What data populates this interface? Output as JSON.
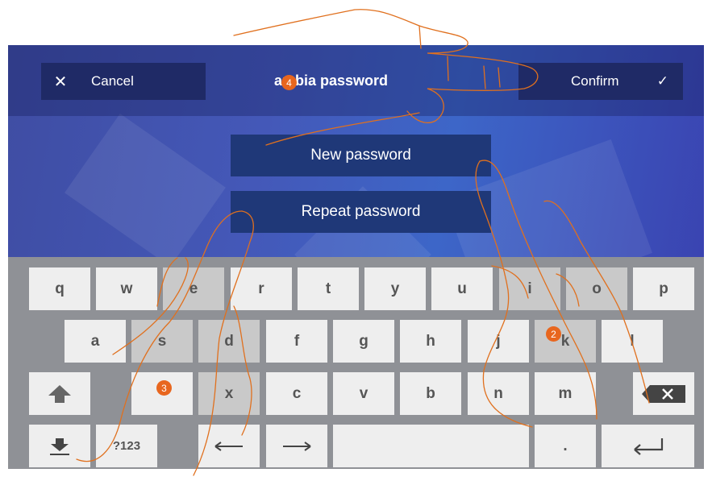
{
  "header": {
    "cancel_label": "Cancel",
    "confirm_label": "Confirm",
    "title": "ambia password"
  },
  "form": {
    "new_password_label": "New password",
    "repeat_password_label": "Repeat password"
  },
  "keyboard": {
    "row1": [
      "q",
      "w",
      "e",
      "r",
      "t",
      "y",
      "u",
      "i",
      "o",
      "p"
    ],
    "row2": [
      "a",
      "s",
      "d",
      "f",
      "g",
      "h",
      "j",
      "k",
      "l"
    ],
    "row3": [
      "x",
      "c",
      "v",
      "b",
      "n",
      "m"
    ],
    "symbols_label": "?123",
    "period_label": "."
  },
  "badges": {
    "step2": "2",
    "step3": "3",
    "step4": "4"
  },
  "colors": {
    "accent": "#e8661e",
    "topbar_button": "#1f2a66",
    "field": "#1f3878"
  }
}
